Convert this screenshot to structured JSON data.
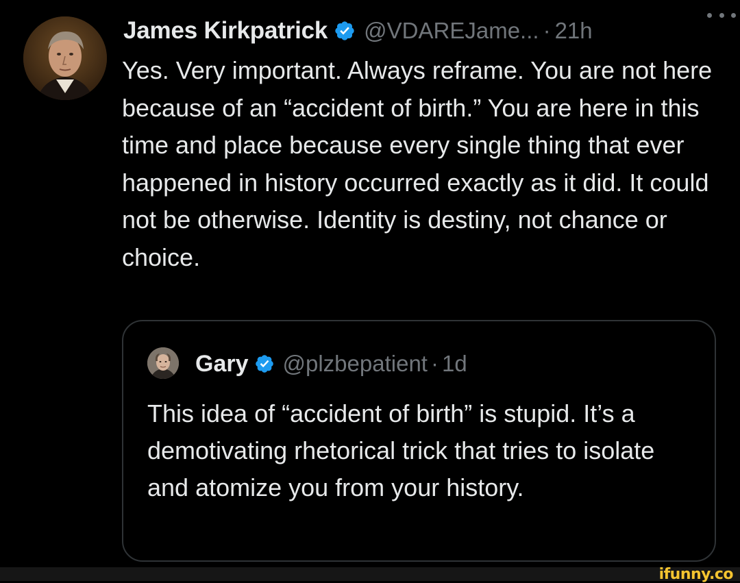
{
  "tweet": {
    "author": {
      "name": "James Kirkpatrick",
      "handle": "@VDAREJame...",
      "separator": "·",
      "time": "21h",
      "verified": true,
      "avatar_icon": "portrait-avatar"
    },
    "more_icon": "more-horizontal-icon",
    "text": "Yes. Very important. Always reframe. You are not here because of an “accident of birth.” You are here in this time and place because every single thing that ever happened in history occurred exactly as it did. It could not be otherwise. Identity is destiny, not chance or choice."
  },
  "quoted_tweet": {
    "author": {
      "name": "Gary",
      "handle": "@plzbepatient",
      "separator": "·",
      "time": "1d",
      "verified": true,
      "avatar_icon": "portrait-avatar"
    },
    "text": "This idea of “accident of birth” is stupid. It’s a demotivating rhetorical trick that tries to isolate and atomize you from your history."
  },
  "watermark": "ifunny.co",
  "colors": {
    "background": "#000000",
    "primary_text": "#e7e9ea",
    "secondary_text": "#71767b",
    "verified_blue": "#1d9bf0",
    "border": "#2f3336",
    "watermark": "#f4c430"
  }
}
